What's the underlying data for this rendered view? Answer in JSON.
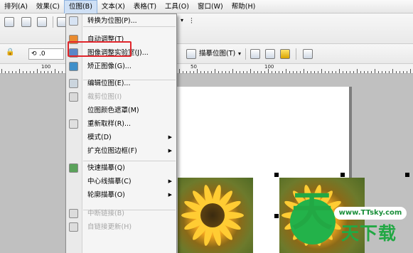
{
  "menubar": {
    "items": [
      "排列(A)",
      "效果(C)",
      "位图(B)",
      "文本(X)",
      "表格(T)",
      "工具(O)",
      "窗口(W)",
      "帮助(H)"
    ]
  },
  "toolbar": {
    "rotation_value": ".0",
    "trace_button_label": "描摹位图(T)"
  },
  "ruler": {
    "labels": [
      "100",
      "50",
      "100"
    ]
  },
  "bitmap_menu": {
    "items": [
      {
        "label": "转换为位图(P)...",
        "icon": "convert-bitmap-icon",
        "enabled": true,
        "submenu": false
      },
      {
        "label": "自动调整(T)",
        "icon": "auto-adjust-icon",
        "enabled": true,
        "submenu": false
      },
      {
        "label": "图像调整实验室(J)...",
        "icon": "image-lab-icon",
        "enabled": true,
        "submenu": false
      },
      {
        "label": "矫正图像(G)...",
        "icon": "straighten-icon",
        "enabled": true,
        "submenu": false
      },
      {
        "label": "编辑位图(E)...",
        "icon": "edit-bitmap-icon",
        "enabled": true,
        "submenu": false
      },
      {
        "label": "裁剪位图(I)",
        "icon": "crop-bitmap-icon",
        "enabled": false,
        "submenu": false
      },
      {
        "label": "位图颜色遮罩(M)",
        "icon": "",
        "enabled": true,
        "submenu": false
      },
      {
        "label": "重新取样(R)...",
        "icon": "resample-icon",
        "enabled": true,
        "submenu": false
      },
      {
        "label": "模式(D)",
        "icon": "",
        "enabled": true,
        "submenu": true
      },
      {
        "label": "扩充位图边框(F)",
        "icon": "",
        "enabled": true,
        "submenu": true
      },
      {
        "label": "快速描摹(Q)",
        "icon": "quick-trace-icon",
        "enabled": true,
        "submenu": false
      },
      {
        "label": "中心线描摹(C)",
        "icon": "",
        "enabled": true,
        "submenu": true
      },
      {
        "label": "轮廓描摹(O)",
        "icon": "",
        "enabled": true,
        "submenu": true
      },
      {
        "label": "中断链接(B)",
        "icon": "break-link-icon",
        "enabled": false,
        "submenu": false
      },
      {
        "label": "自链接更新(H)",
        "icon": "update-link-icon",
        "enabled": false,
        "submenu": false
      }
    ]
  },
  "watermark": {
    "glyph": "天",
    "url": "www.TTsky.com",
    "brand": "天下载"
  },
  "colors": {
    "highlight_border": "#e0252b",
    "watermark_green": "#22a844"
  }
}
